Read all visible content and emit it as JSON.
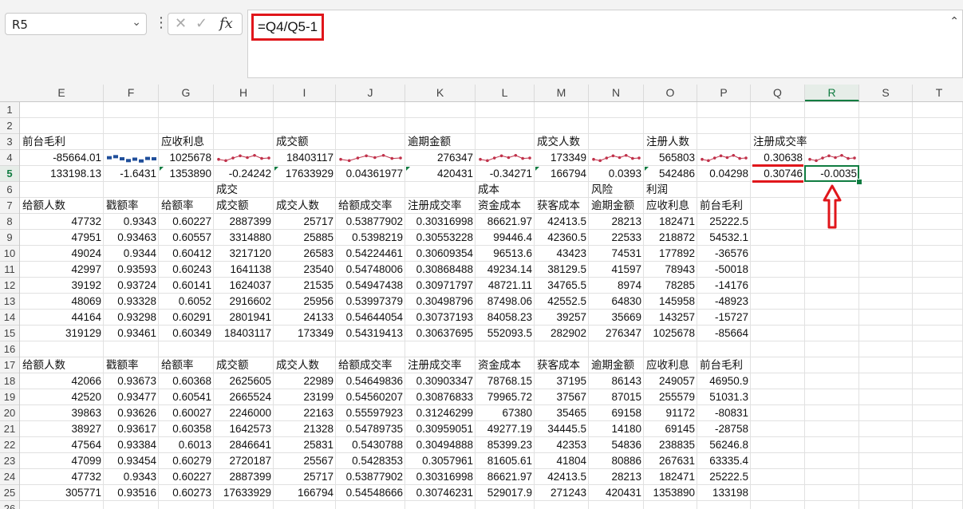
{
  "name_box": {
    "value": "R5"
  },
  "formula_bar": {
    "formula": "=Q4/Q5-1",
    "fx_label": "fx"
  },
  "columns": [
    "E",
    "F",
    "G",
    "H",
    "I",
    "J",
    "K",
    "L",
    "M",
    "N",
    "O",
    "P",
    "Q",
    "R",
    "S",
    "T"
  ],
  "selected_column": "R",
  "selected_row": 5,
  "rows": [
    "1",
    "2",
    "3",
    "4",
    "5",
    "6",
    "7",
    "8",
    "9",
    "10",
    "11",
    "12",
    "13",
    "14",
    "15",
    "16",
    "17",
    "18",
    "19",
    "20",
    "21",
    "22",
    "23",
    "24",
    "25",
    "26"
  ],
  "header_block": {
    "row3": [
      "前台毛利",
      "",
      "应收利息",
      "",
      "成交额",
      "",
      "逾期金额",
      "",
      "成交人数",
      "",
      "注册人数",
      "",
      "注册成交率",
      ""
    ],
    "row4": [
      "-85664.01",
      "",
      "1025678",
      "",
      "18403117",
      "",
      "276347",
      "",
      "173349",
      "",
      "565803",
      "",
      "0.30638",
      ""
    ],
    "row5": [
      "133198.13",
      "-1.6431",
      "1353890",
      "-0.24242",
      "17633929",
      "0.04361977",
      "420431",
      "-0.34271",
      "166794",
      "0.0393",
      "542486",
      "0.04298",
      "0.30746",
      "-0.0035"
    ],
    "row6": [
      "",
      "",
      "",
      "成交",
      "",
      "",
      "",
      "成本",
      "",
      "风险",
      "利润",
      "",
      "",
      ""
    ]
  },
  "table_headers": [
    "给额人数",
    "戳额率",
    "给额率",
    "成交额",
    "成交人数",
    "给额成交率",
    "注册成交率",
    "资金成本",
    "获客成本",
    "逾期金额",
    "应收利息",
    "前台毛利"
  ],
  "table1": [
    [
      "47732",
      "0.9343",
      "0.60227",
      "2887399",
      "25717",
      "0.53877902",
      "0.30316998",
      "86621.97",
      "42413.5",
      "28213",
      "182471",
      "25222.5"
    ],
    [
      "47951",
      "0.93463",
      "0.60557",
      "3314880",
      "25885",
      "0.5398219",
      "0.30553228",
      "99446.4",
      "42360.5",
      "22533",
      "218872",
      "54532.1"
    ],
    [
      "49024",
      "0.9344",
      "0.60412",
      "3217120",
      "26583",
      "0.54224461",
      "0.30609354",
      "96513.6",
      "43423",
      "74531",
      "177892",
      "-36576"
    ],
    [
      "42997",
      "0.93593",
      "0.60243",
      "1641138",
      "23540",
      "0.54748006",
      "0.30868488",
      "49234.14",
      "38129.5",
      "41597",
      "78943",
      "-50018"
    ],
    [
      "39192",
      "0.93724",
      "0.60141",
      "1624037",
      "21535",
      "0.54947438",
      "0.30971797",
      "48721.11",
      "34765.5",
      "8974",
      "78285",
      "-14176"
    ],
    [
      "48069",
      "0.93328",
      "0.6052",
      "2916602",
      "25956",
      "0.53997379",
      "0.30498796",
      "87498.06",
      "42552.5",
      "64830",
      "145958",
      "-48923"
    ],
    [
      "44164",
      "0.93298",
      "0.60291",
      "2801941",
      "24133",
      "0.54644054",
      "0.30737193",
      "84058.23",
      "39257",
      "35669",
      "143257",
      "-15727"
    ],
    [
      "319129",
      "0.93461",
      "0.60349",
      "18403117",
      "173349",
      "0.54319413",
      "0.30637695",
      "552093.5",
      "282902",
      "276347",
      "1025678",
      "-85664"
    ]
  ],
  "table2": [
    [
      "42066",
      "0.93673",
      "0.60368",
      "2625605",
      "22989",
      "0.54649836",
      "0.30903347",
      "78768.15",
      "37195",
      "86143",
      "249057",
      "46950.9"
    ],
    [
      "42520",
      "0.93477",
      "0.60541",
      "2665524",
      "23199",
      "0.54560207",
      "0.30876833",
      "79965.72",
      "37567",
      "87015",
      "255579",
      "51031.3"
    ],
    [
      "39863",
      "0.93626",
      "0.60027",
      "2246000",
      "22163",
      "0.55597923",
      "0.31246299",
      "67380",
      "35465",
      "69158",
      "91172",
      "-80831"
    ],
    [
      "38927",
      "0.93617",
      "0.60358",
      "1642573",
      "21328",
      "0.54789735",
      "0.30959051",
      "49277.19",
      "34445.5",
      "14180",
      "69145",
      "-28758"
    ],
    [
      "47564",
      "0.93384",
      "0.6013",
      "2846641",
      "25831",
      "0.5430788",
      "0.30494888",
      "85399.23",
      "42353",
      "54836",
      "238835",
      "56246.8"
    ],
    [
      "47099",
      "0.93454",
      "0.60279",
      "2720187",
      "25567",
      "0.5428353",
      "0.3057961",
      "81605.61",
      "41804",
      "80886",
      "267631",
      "63335.4"
    ],
    [
      "47732",
      "0.9343",
      "0.60227",
      "2887399",
      "25717",
      "0.53877902",
      "0.30316998",
      "86621.97",
      "42413.5",
      "28213",
      "182471",
      "25222.5"
    ],
    [
      "305771",
      "0.93516",
      "0.60273",
      "17633929",
      "166794",
      "0.54548666",
      "0.30746231",
      "529017.9",
      "271243",
      "420431",
      "1353890",
      "133198"
    ]
  ],
  "colors": {
    "accent": "#107c41",
    "annotation": "#e0161b",
    "sparkline": "#1f4e9a",
    "sparkline_line": "#c0314a"
  }
}
